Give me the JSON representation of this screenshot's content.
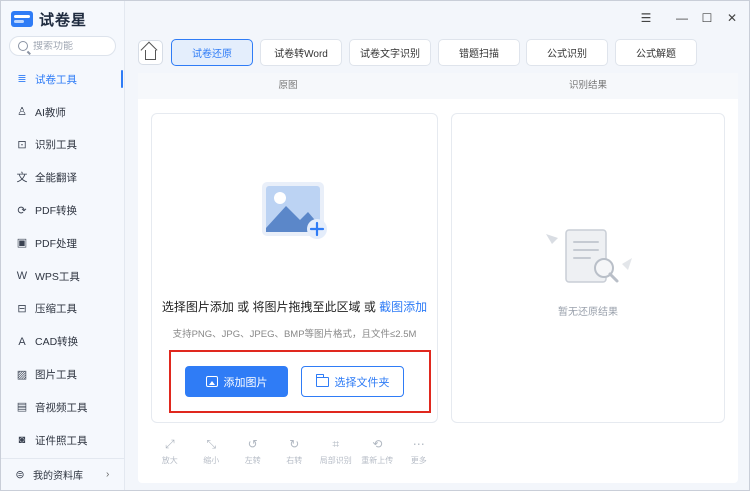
{
  "app": {
    "title": "试卷星"
  },
  "window_controls": {
    "menu": "☰",
    "minimize": "—",
    "maximize": "☐",
    "close": "✕"
  },
  "search": {
    "placeholder": "搜索功能"
  },
  "sidebar": {
    "items": [
      {
        "label": "试卷工具",
        "icon": "exam-icon",
        "glyph": "≣",
        "active": true
      },
      {
        "label": "AI教师",
        "icon": "ai-teacher-icon",
        "glyph": "♙"
      },
      {
        "label": "识别工具",
        "icon": "scan-icon",
        "glyph": "⊡"
      },
      {
        "label": "全能翻译",
        "icon": "translate-icon",
        "glyph": "文"
      },
      {
        "label": "PDF转换",
        "icon": "pdf-convert-icon",
        "glyph": "⟳"
      },
      {
        "label": "PDF处理",
        "icon": "pdf-process-icon",
        "glyph": "▣"
      },
      {
        "label": "WPS工具",
        "icon": "wps-icon",
        "glyph": "W"
      },
      {
        "label": "压缩工具",
        "icon": "compress-icon",
        "glyph": "⊟"
      },
      {
        "label": "CAD转换",
        "icon": "cad-icon",
        "glyph": "A"
      },
      {
        "label": "图片工具",
        "icon": "image-tools-icon",
        "glyph": "▨"
      },
      {
        "label": "音视频工具",
        "icon": "media-icon",
        "glyph": "▤"
      },
      {
        "label": "证件照工具",
        "icon": "id-photo-icon",
        "glyph": "◙"
      }
    ],
    "bottom": {
      "label": "我的资料库",
      "glyph": "⊜",
      "chevron": "›"
    }
  },
  "tabs": [
    {
      "label": "试卷还原",
      "active": true
    },
    {
      "label": "试卷转Word"
    },
    {
      "label": "试卷文字识别"
    },
    {
      "label": "错题扫描"
    },
    {
      "label": "公式识别"
    },
    {
      "label": "公式解题"
    }
  ],
  "columns": {
    "left": "原图",
    "right": "识别结果"
  },
  "upload": {
    "prompt_main": "选择图片添加 或 将图片拖拽至此区域 或 ",
    "prompt_link": "截图添加",
    "hint": "支持PNG、JPG、JPEG、BMP等图片格式，且文件≤2.5M",
    "add_image": "添加图片",
    "choose_folder": "选择文件夹"
  },
  "result": {
    "empty": "暂无还原结果"
  },
  "tools": [
    {
      "label": "放大",
      "glyph": "⤢",
      "icon": "zoom-in-icon"
    },
    {
      "label": "缩小",
      "glyph": "⤡",
      "icon": "zoom-out-icon"
    },
    {
      "label": "左转",
      "glyph": "↺",
      "icon": "rotate-left-icon"
    },
    {
      "label": "右转",
      "glyph": "↻",
      "icon": "rotate-right-icon"
    },
    {
      "label": "局部识别",
      "glyph": "⌗",
      "icon": "partial-recognize-icon"
    },
    {
      "label": "重新上传",
      "glyph": "⟲",
      "icon": "reupload-icon"
    },
    {
      "label": "更多",
      "glyph": "⋯",
      "icon": "more-icon"
    }
  ],
  "colors": {
    "accent": "#2f7cf6",
    "highlight": "#e0281e"
  }
}
